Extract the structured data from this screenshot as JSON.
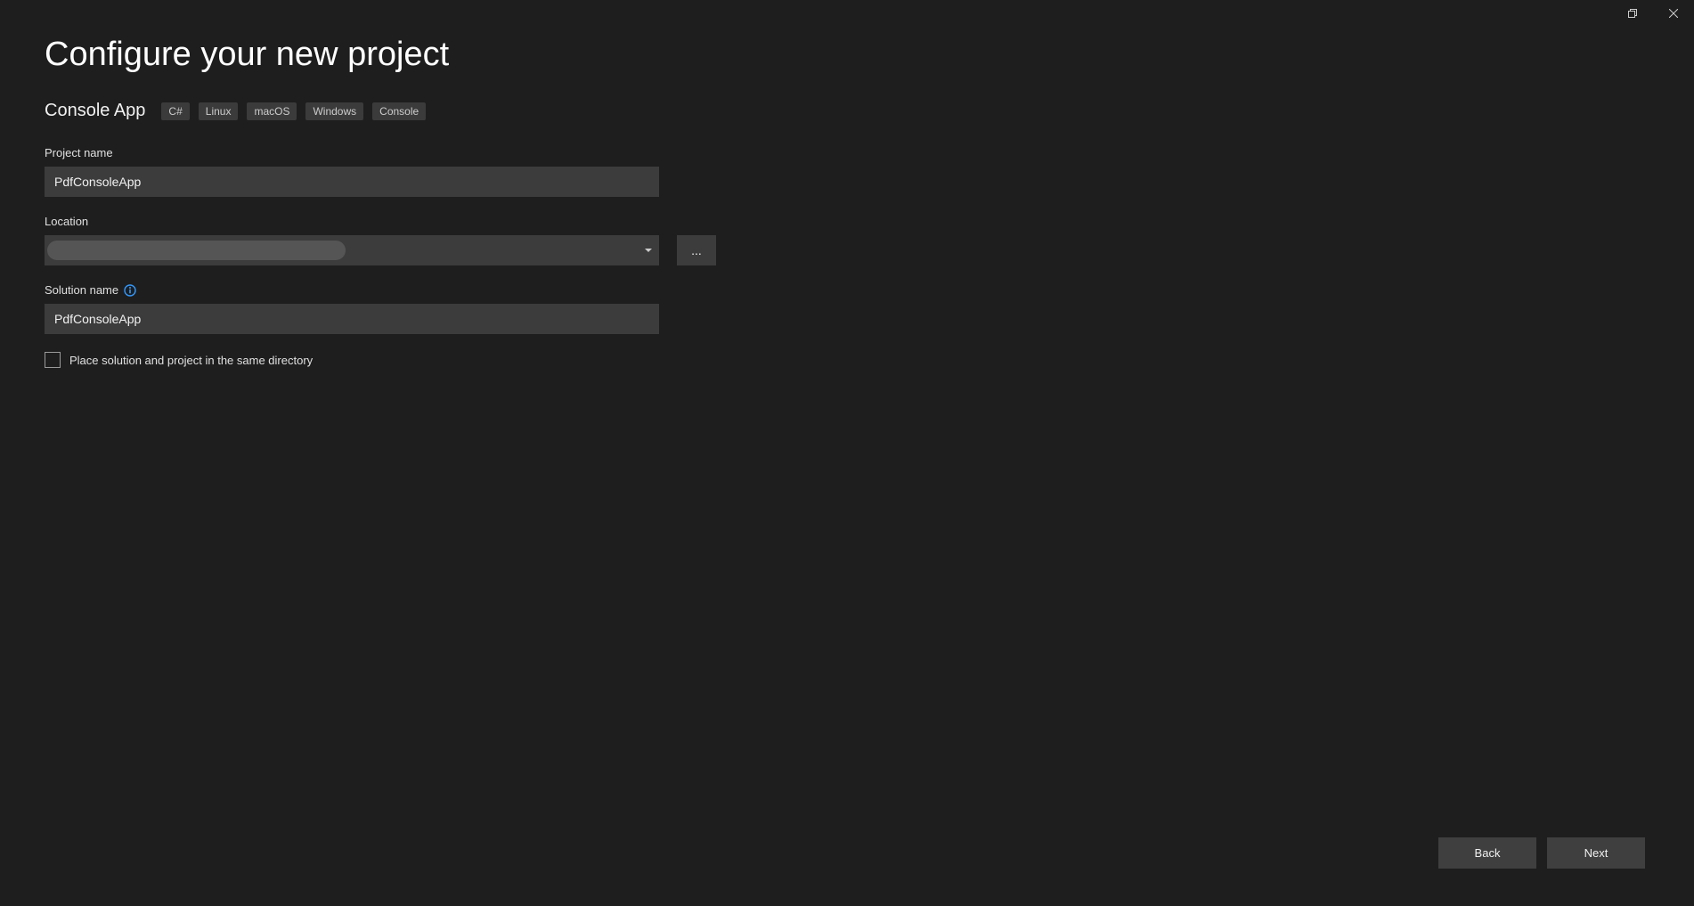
{
  "window": {
    "title": "Configure your new project"
  },
  "template": {
    "name": "Console App",
    "tags": [
      "C#",
      "Linux",
      "macOS",
      "Windows",
      "Console"
    ]
  },
  "fields": {
    "project_name": {
      "label": "Project name",
      "value": "PdfConsoleApp"
    },
    "location": {
      "label": "Location",
      "value": "",
      "browse_label": "..."
    },
    "solution_name": {
      "label": "Solution name",
      "value": "PdfConsoleApp"
    },
    "same_directory": {
      "label": "Place solution and project in the same directory",
      "checked": false
    }
  },
  "footer": {
    "back_label": "Back",
    "next_label": "Next"
  }
}
